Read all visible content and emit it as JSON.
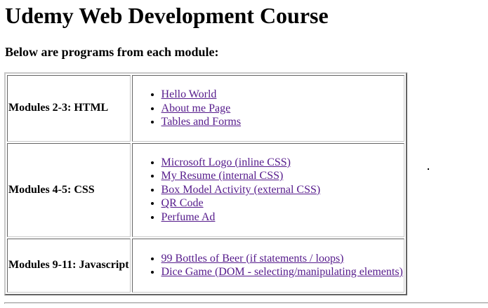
{
  "page": {
    "title": "Udemy Web Development Course",
    "subtitle": "Below are programs from each module:"
  },
  "modules": [
    {
      "name": "Modules 2-3: HTML",
      "links": [
        "Hello World",
        "About me Page",
        "Tables and Forms"
      ]
    },
    {
      "name": "Modules 4-5: CSS",
      "links": [
        "Microsoft Logo (inline CSS)",
        "My Resume (internal CSS)",
        "Box Model Activity (external CSS)",
        "QR Code",
        "Perfume Ad"
      ]
    },
    {
      "name": "Modules 9-11: Javascript",
      "links": [
        "99 Bottles of Beer (if statements / loops)",
        "Dice Game (DOM - selecting/manipulating elements)"
      ]
    }
  ],
  "colors": {
    "visited_link": "#551a8b",
    "text": "#000000",
    "background": "#ffffff"
  }
}
